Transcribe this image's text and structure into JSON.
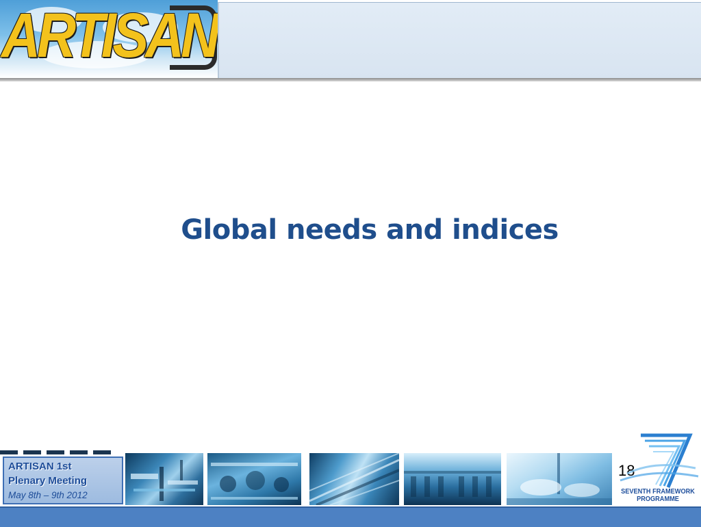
{
  "header": {
    "logo_text": "ARTISAN"
  },
  "slide": {
    "title": "Global needs and indices",
    "page_number": "18"
  },
  "footer": {
    "line1": "ARTISAN 1st",
    "line2": "Plenary Meeting",
    "line3": "May  8th – 9th  2012",
    "fp7_line1": "SEVENTH FRAMEWORK",
    "fp7_line2": "PROGRAMME",
    "photos": [
      {
        "name": "factory-photo-1"
      },
      {
        "name": "factory-photo-2"
      },
      {
        "name": "factory-photo-3"
      },
      {
        "name": "factory-photo-4"
      },
      {
        "name": "factory-photo-5"
      }
    ]
  },
  "colors": {
    "title": "#1f4e8c",
    "footer_text": "#1e4d99",
    "bottom_bar": "#4d81c3",
    "logo_yellow": "#f3c21c"
  }
}
